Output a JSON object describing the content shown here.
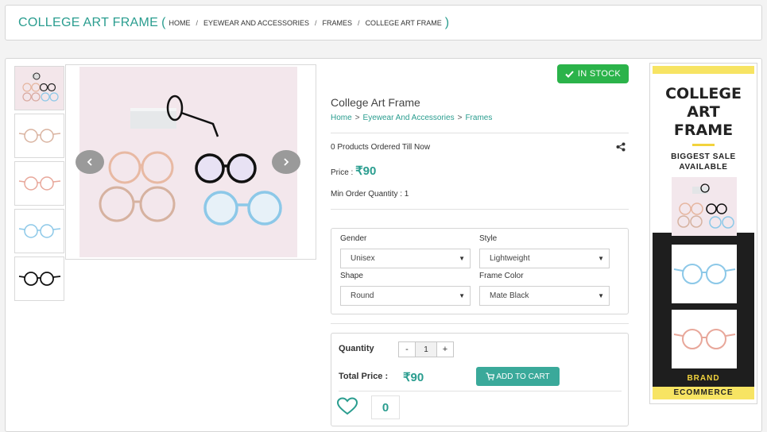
{
  "header": {
    "title": "COLLEGE ART FRAME",
    "open_paren": "(",
    "close_paren": ")",
    "breadcrumbs": [
      "HOME",
      "EYEWEAR AND ACCESSORIES",
      "FRAMES",
      "COLLEGE ART FRAME"
    ],
    "separator": "/"
  },
  "gallery": {
    "prev_icon": "chevron-left-icon",
    "next_icon": "chevron-right-icon",
    "thumb_colors": [
      "mixed",
      "peach",
      "pink",
      "light-blue",
      "black"
    ]
  },
  "product": {
    "stock_label": "IN STOCK",
    "name": "College Art Frame",
    "breadcrumbs": [
      "Home",
      "Eyewear And Accessories",
      "Frames"
    ],
    "crumb_sep": ">",
    "ordered_text": "0 Products Ordered Till Now",
    "price_label": "Price :",
    "price_value": "₹90",
    "min_order": "Min Order Quantity : 1"
  },
  "options": {
    "gender_label": "Gender",
    "gender_value": "Unisex",
    "style_label": "Style",
    "style_value": "Lightweight",
    "shape_label": "Shape",
    "shape_value": "Round",
    "color_label": "Frame Color",
    "color_value": "Mate Black"
  },
  "cart": {
    "quantity_label": "Quantity",
    "minus": "-",
    "quantity_value": "1",
    "plus": "+",
    "total_label": "Total Price :",
    "total_value": "₹90",
    "add_to_cart": "ADD TO CART",
    "likes_count": "0"
  },
  "banner": {
    "title_lines": [
      "COLLEGE",
      "ART",
      "FRAME"
    ],
    "subtitle_lines": [
      "BIGGEST SALE",
      "AVAILABLE"
    ],
    "brand": "BRAND",
    "ecommerce": "ECOMMERCE"
  },
  "colors": {
    "accent": "#2a9d8f",
    "stock_green": "#2bb34a",
    "cart_button": "#3aa99a",
    "banner_yellow": "#f7e463"
  }
}
